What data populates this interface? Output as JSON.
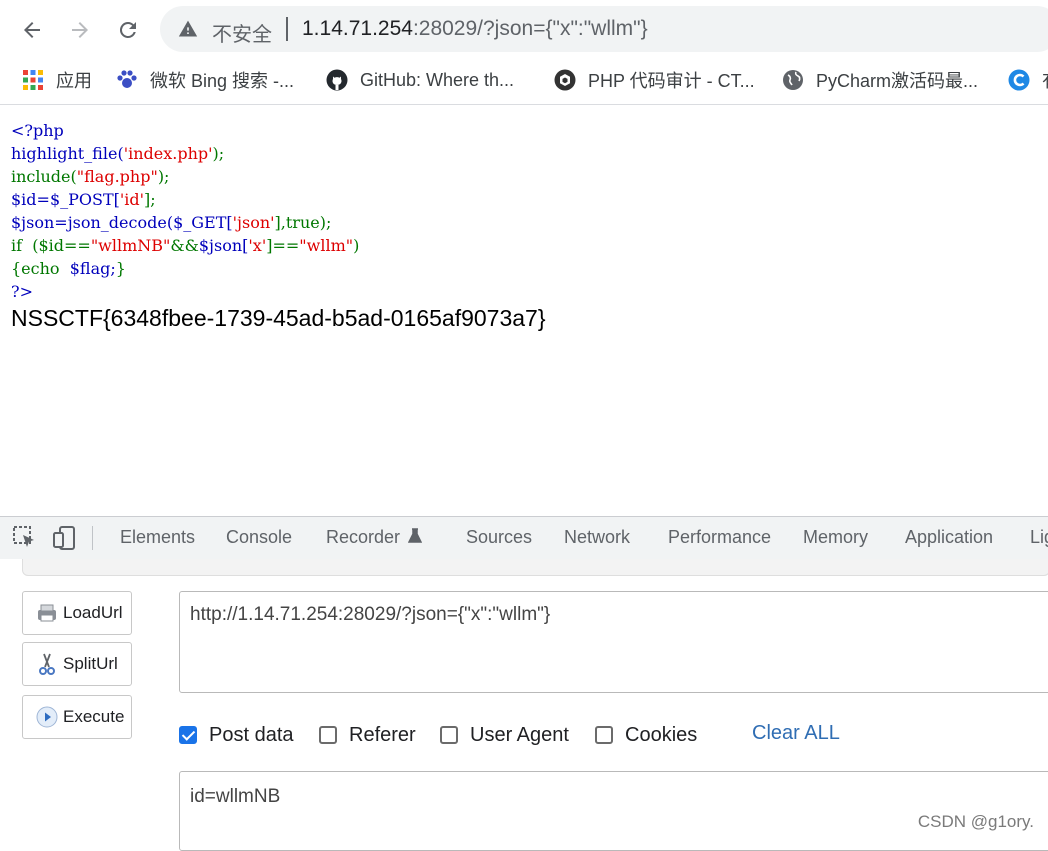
{
  "browser": {
    "insecure_label": "不安全",
    "url_host": "1.14.71.254",
    "url_rest": ":28029/?json={\"x\":\"wllm\"}"
  },
  "bookmarks": [
    {
      "label": "应用",
      "icon": "apps-grid-icon"
    },
    {
      "label": "微软 Bing 搜索 -...",
      "icon": "bing-paw-icon"
    },
    {
      "label": "GitHub: Where th...",
      "icon": "github-icon"
    },
    {
      "label": "PHP 代码审计 - CT...",
      "icon": "php-audit-icon"
    },
    {
      "label": "PyCharm激活码最...",
      "icon": "globe-icon"
    },
    {
      "label": "有",
      "icon": "c-logo-icon"
    }
  ],
  "page": {
    "code": {
      "line1": "<?php",
      "line2": [
        "highlight_file(",
        "'index.php'",
        ");"
      ],
      "line3": [
        "include(",
        "\"flag.php\"",
        ");"
      ],
      "line4": [
        "$id=$_POST[",
        "'id'",
        "];"
      ],
      "line5": [
        "$json=json_decode($_GET[",
        "'json'",
        "],true);"
      ],
      "line6": [
        "if  ($id==",
        "\"wllmNB\"",
        "&&",
        "$json[",
        "'x'",
        "]==",
        "\"wllm\"",
        ")"
      ],
      "line7": [
        "{echo  ",
        "$flag;",
        "}"
      ],
      "line8": "?>"
    },
    "flag": "NSSCTF{6348fbee-1739-45ad-b5ad-0165af9073a7}"
  },
  "devtools": {
    "tabs": [
      "Elements",
      "Console",
      "Recorder",
      "Sources",
      "Network",
      "Performance",
      "Memory",
      "Application",
      "Lig"
    ]
  },
  "hackbar": {
    "load_url": "LoadUrl",
    "split_url": "SplitUrl",
    "execute": "Execute",
    "url_value": "http://1.14.71.254:28029/?json={\"x\":\"wllm\"}",
    "options": {
      "post_data": {
        "label": "Post data",
        "checked": true
      },
      "referer": {
        "label": "Referer",
        "checked": false
      },
      "user_agent": {
        "label": "User Agent",
        "checked": false
      },
      "cookies": {
        "label": "Cookies",
        "checked": false
      }
    },
    "clear_all": "Clear ALL",
    "post_value": "id=wllmNB"
  },
  "watermark": "CSDN @g1ory.",
  "colors": {
    "code_default": "#0000BB",
    "code_string": "#DD0000",
    "code_keyword": "#007700",
    "link_blue": "#2f6db3",
    "checkbox_blue": "#1a73e8"
  }
}
